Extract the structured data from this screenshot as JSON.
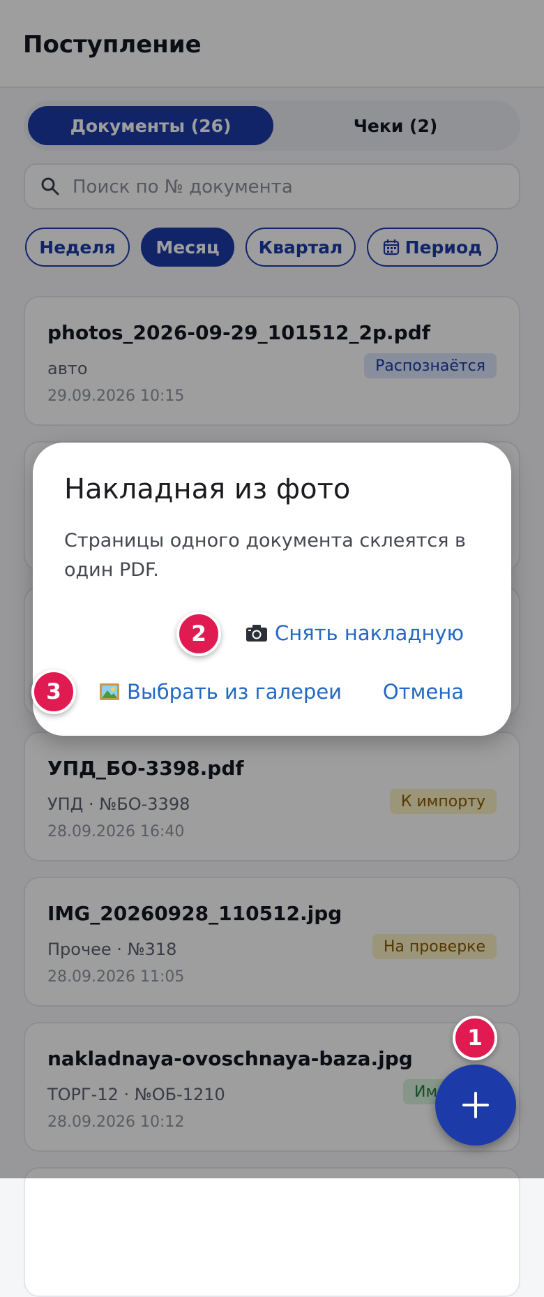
{
  "header": {
    "title": "Поступление"
  },
  "segments": [
    {
      "label": "Документы (26)",
      "active": true
    },
    {
      "label": "Чеки (2)",
      "active": false
    }
  ],
  "search": {
    "placeholder": "Поиск по № документа",
    "icon": "search-icon"
  },
  "period_chips": [
    {
      "label": "Неделя",
      "active": false
    },
    {
      "label": "Месяц",
      "active": true
    },
    {
      "label": "Квартал",
      "active": false
    },
    {
      "label": "Период",
      "active": false,
      "icon": "calendar-icon"
    }
  ],
  "documents": [
    {
      "name": "photos_2026-09-29_101512_2p.pdf",
      "sub": "авто",
      "date": "29.09.2026 10:15",
      "status": "Распознаётся",
      "status_color": "#1c3aa8"
    },
    {
      "name": "УПД_БО-3398.pdf",
      "sub": "УПД · №БО-3398",
      "date": "28.09.2026 16:40",
      "status": "К импорту",
      "status_color": "#8a5a00"
    },
    {
      "name": "IMG_20260928_110512.jpg",
      "sub": "Прочее · №318",
      "date": "28.09.2026 11:05",
      "status": "На проверке",
      "status_color": "#8a5a00"
    },
    {
      "name": "nakladnaya-ovoschnaya-baza.jpg",
      "sub": "ТОРГ-12 · №ОБ-1210",
      "date": "28.09.2026 10:12",
      "status": "Импорти",
      "status_color": "#1f7a3a"
    }
  ],
  "dialog": {
    "title": "Накладная из фото",
    "body": "Страницы одного документа склеятся в один PDF.",
    "camera_label": "Снять накладную",
    "camera_icon": "camera-icon",
    "gallery_label": "Выбрать из галереи",
    "gallery_icon": "picture-icon",
    "cancel_label": "Отмена"
  },
  "fab": {
    "icon": "plus-icon"
  },
  "markers": [
    "1",
    "2",
    "3"
  ],
  "colors": {
    "accent": "#1c3aa8",
    "link": "#2368c4",
    "marker": "#e01b52"
  }
}
